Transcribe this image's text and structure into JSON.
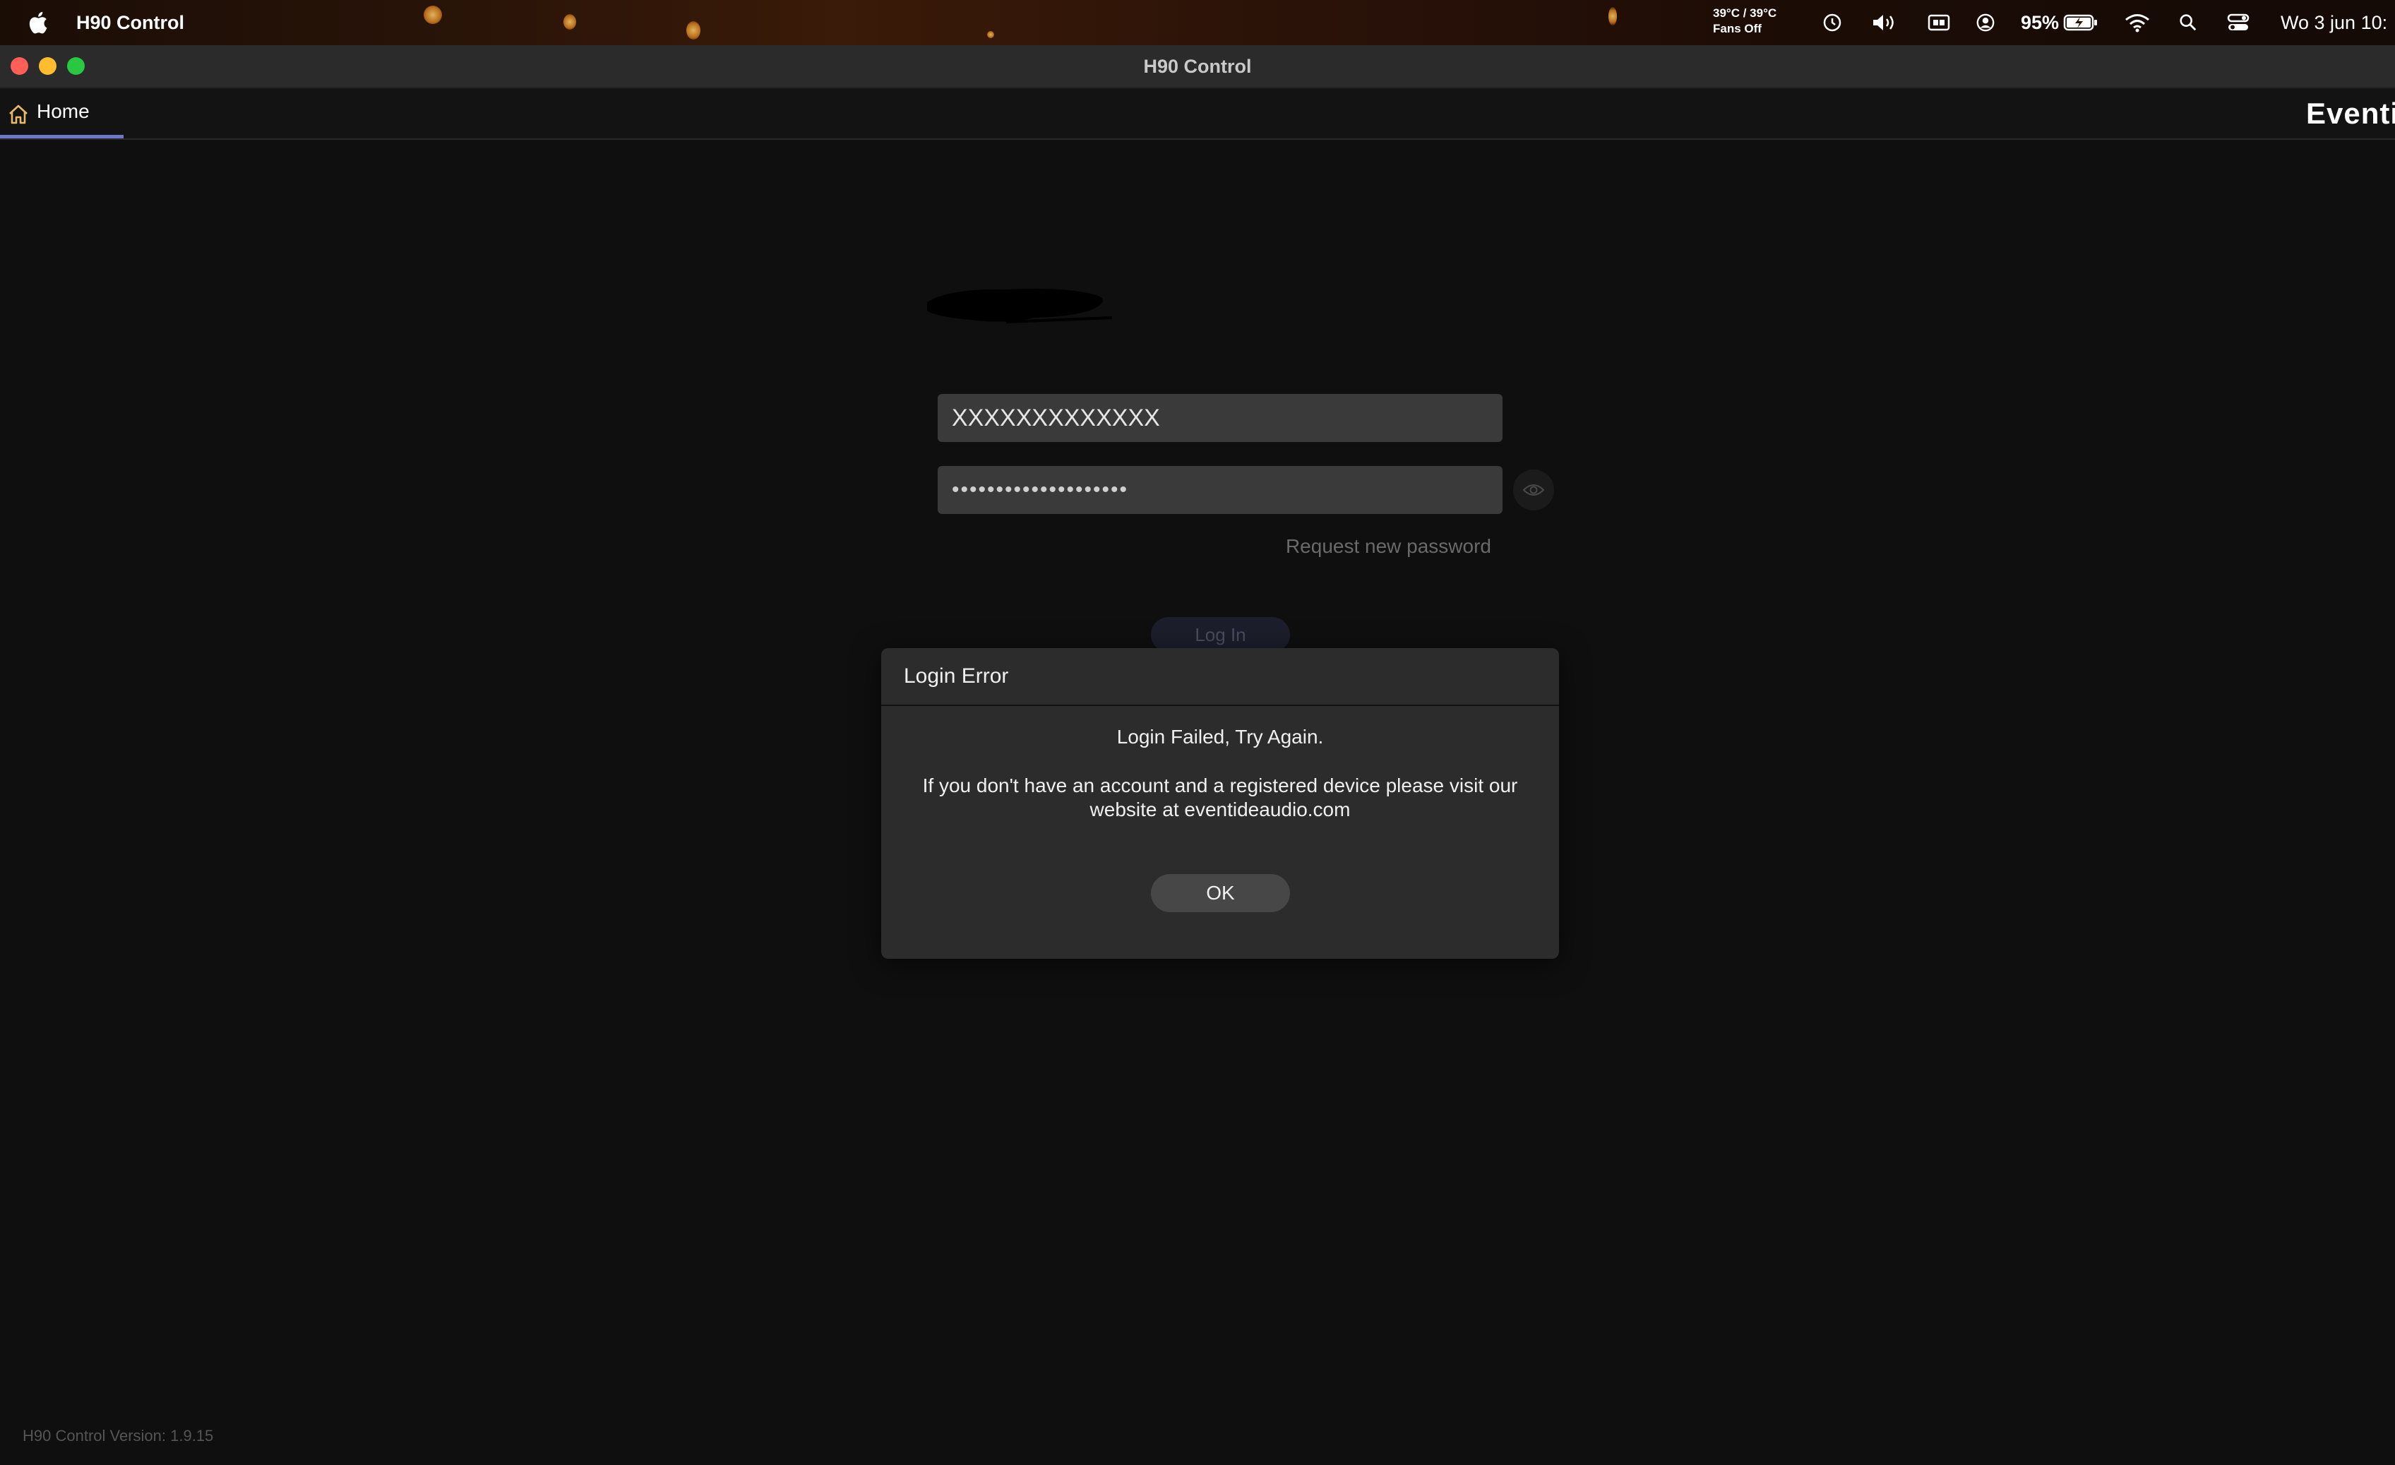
{
  "menubar": {
    "app_name": "H90 Control",
    "temperature": "39°C / 39°C",
    "fans": "Fans Off",
    "battery_percent": "95%",
    "clock": "Wo 3 jun  10:"
  },
  "window": {
    "title": "H90 Control"
  },
  "tabs": {
    "home_label": "Home",
    "brand": "Eventide"
  },
  "login_form": {
    "username_value": "XXXXXXXXXXXXX",
    "password_value": "••••••••••••••••••••",
    "request_password_label": "Request new password",
    "login_button_label": "Log In"
  },
  "dialog": {
    "title": "Login Error",
    "message_primary": "Login Failed, Try Again.",
    "message_secondary": "If you don't have an account and a registered device please visit our website at eventideaudio.com",
    "ok_label": "OK"
  },
  "footer": {
    "version_text": "H90 Control Version: 1.9.15"
  }
}
